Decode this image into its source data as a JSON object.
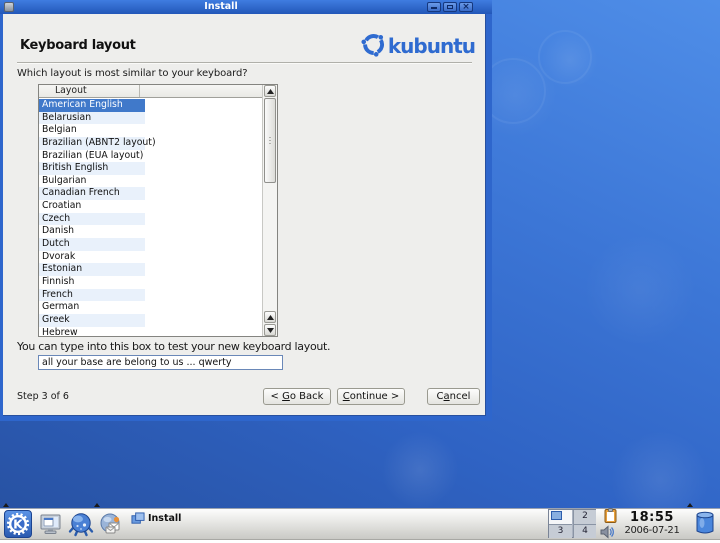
{
  "window": {
    "title": "Install",
    "heading": "Keyboard layout",
    "question": "Which layout is most similar to your keyboard?",
    "list": {
      "header": "Layout",
      "selected_index": 0,
      "selected_item": "American English",
      "items": [
        "American English",
        "Belarusian",
        "Belgian",
        "Brazilian (ABNT2 layout)",
        "Brazilian (EUA layout)",
        "British English",
        "Bulgarian",
        "Canadian French",
        "Croatian",
        "Czech",
        "Danish",
        "Dutch",
        "Dvorak",
        "Estonian",
        "Finnish",
        "French",
        "German",
        "Greek",
        "Hebrew"
      ]
    },
    "test_label": "You can type into this box to test your new keyboard layout.",
    "test_value": "all your base are belong to us ... qwerty",
    "step": "Step 3 of 6",
    "buttons": {
      "back_label": "< Go Back",
      "continue_label": "Continue >",
      "cancel_label": "Cancel",
      "back_pre": "< ",
      "back_mn": "G",
      "back_post": "o Back",
      "continue_mn": "C",
      "continue_post": "ontinue >",
      "cancel_pre": "C",
      "cancel_mn": "a",
      "cancel_post": "ncel"
    },
    "logo_text": "kubuntu"
  },
  "taskbar": {
    "task_label": "Install",
    "pager": {
      "cell2": "2",
      "cell3": "3",
      "cell4": "4",
      "active_desktop": 1
    },
    "clock_time": "18:55",
    "clock_date": "2006-07-21"
  },
  "icons": {
    "titlebar": [
      "window-icon",
      "minimize-icon",
      "maximize-icon",
      "close-icon"
    ],
    "logo": "kubuntu-circle-of-friends-icon",
    "scrollbar": [
      "scroll-up-icon",
      "scroll-down-icon"
    ],
    "taskbar_left": [
      "kmenu-k-gear-icon",
      "system-menu-icon",
      "konqueror-globe-icon",
      "kontact-globe-mail-icon",
      "install-window-icon"
    ],
    "tray": [
      "klipper-clipboard-icon",
      "volume-speaker-icon",
      "device-notifier-icon"
    ],
    "panel": [
      "hidden-applet-arrow-icon"
    ]
  },
  "colors": {
    "titlebar_blue": "#2a5fc4",
    "selection_blue": "#4079ca",
    "kubuntu_blue": "#2f6bd0",
    "desktop_blue": "#2f63c4",
    "row_alt_tint": "#e9f1fb"
  }
}
